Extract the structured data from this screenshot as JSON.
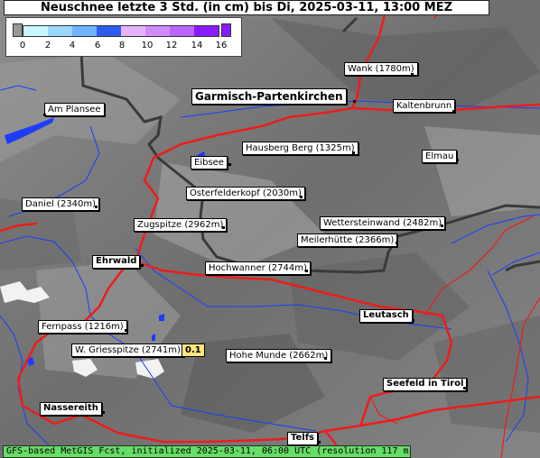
{
  "title": "Neuschnee letzte 3 Std. (in cm) bis Di, 2025-03-11, 13:00 MEZ",
  "legend": {
    "ticks": [
      "0",
      "2",
      "4",
      "6",
      "8",
      "10",
      "12",
      "14",
      "16"
    ],
    "colors": [
      "#c8f7ff",
      "#9ad8ff",
      "#6fb4ff",
      "#4f8fff",
      "#2a5cf0",
      "#e6b4ff",
      "#d08cff",
      "#b966ff"
    ]
  },
  "places": [
    {
      "name": "Wank (1780m)"
    },
    {
      "name": "Garmisch-Partenkirchen"
    },
    {
      "name": "Kaltenbrunn"
    },
    {
      "name": "Am Plansee"
    },
    {
      "name": "Hausberg Berg (1325m)"
    },
    {
      "name": "Eibsee"
    },
    {
      "name": "Elmau"
    },
    {
      "name": "Osterfelderkopf (2030m)"
    },
    {
      "name": "Daniel (2340m)"
    },
    {
      "name": "Zugspitze (2962m)"
    },
    {
      "name": "Wettersteinwand (2482m)"
    },
    {
      "name": "Meilerhütte (2366m)"
    },
    {
      "name": "Ehrwald"
    },
    {
      "name": "Hochwanner (2744m)"
    },
    {
      "name": "Leutasch"
    },
    {
      "name": "Fernpass (1216m)"
    },
    {
      "name": "W. Griesspitze (2741m)"
    },
    {
      "name": "Hohe Munde (2662m)"
    },
    {
      "name": "Seefeld in Tirol"
    },
    {
      "name": "Nassereith"
    },
    {
      "name": "Telfs"
    }
  ],
  "values": {
    "griesspitze": "0.1"
  },
  "footer": "GFS-based MetGIS Fcst, initialized 2025-03-11, 06:00 UTC  (resolution 117 m X 173 m)"
}
